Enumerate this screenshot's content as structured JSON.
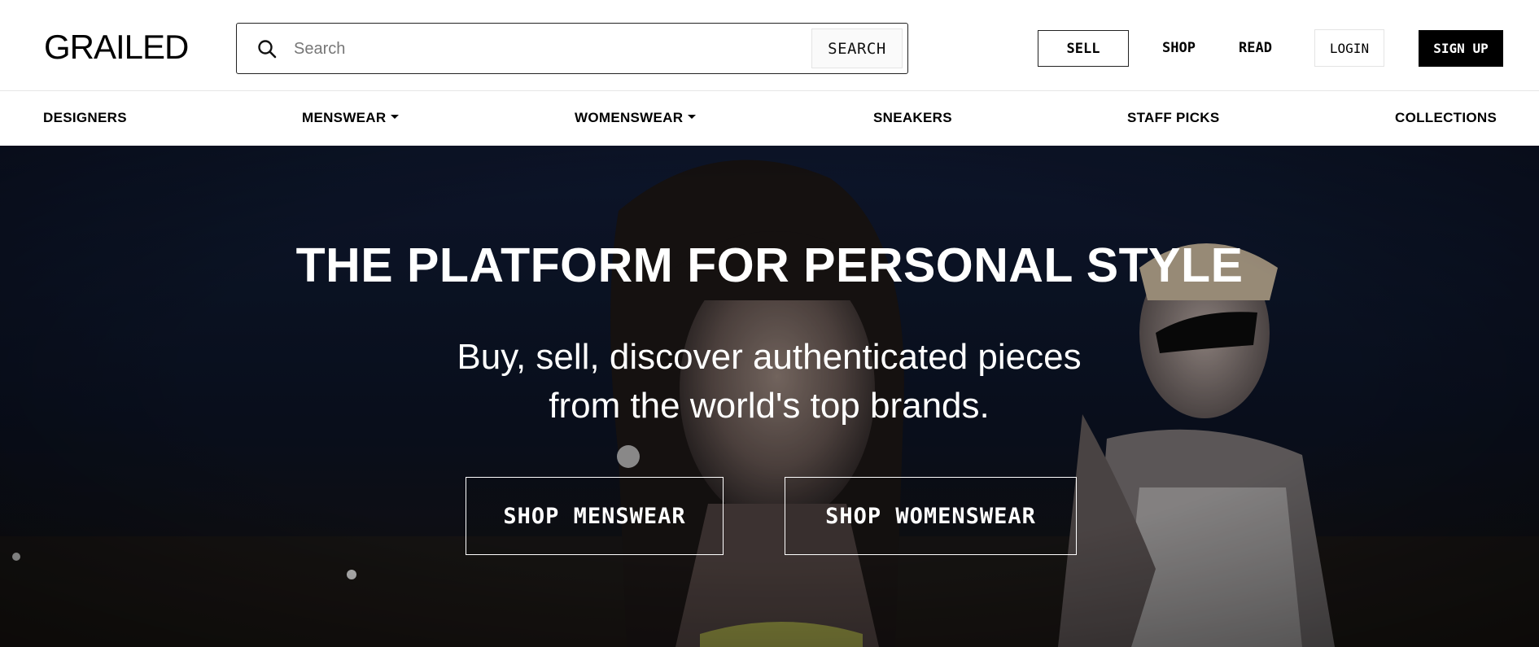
{
  "header": {
    "logo": "GRAILED",
    "search": {
      "placeholder": "Search",
      "value": "",
      "button_label": "SEARCH",
      "icon": "search-icon"
    },
    "sell_label": "SELL",
    "shop_label": "SHOP",
    "read_label": "READ",
    "login_label": "LOGIN",
    "signup_label": "SIGN UP"
  },
  "category_nav": {
    "items": [
      {
        "label": "DESIGNERS",
        "has_dropdown": false
      },
      {
        "label": "MENSWEAR",
        "has_dropdown": true
      },
      {
        "label": "WOMENSWEAR",
        "has_dropdown": true
      },
      {
        "label": "SNEAKERS",
        "has_dropdown": false
      },
      {
        "label": "STAFF PICKS",
        "has_dropdown": false
      },
      {
        "label": "COLLECTIONS",
        "has_dropdown": false
      }
    ]
  },
  "hero": {
    "title": "THE PLATFORM FOR PERSONAL STYLE",
    "subtitle_line1": "Buy, sell, discover authenticated pieces",
    "subtitle_line2": "from the world's top brands.",
    "cta_menswear": "SHOP MENSWEAR",
    "cta_womenswear": "SHOP WOMENSWEAR"
  },
  "colors": {
    "brand_black": "#000000",
    "hero_overlay": "#0d1424",
    "text_on_hero": "#ffffff"
  }
}
